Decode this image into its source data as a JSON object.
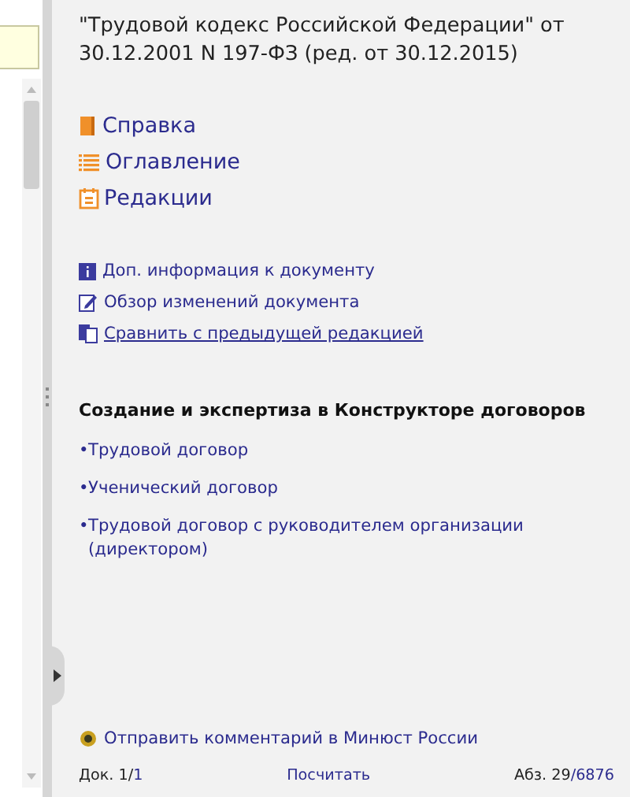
{
  "document": {
    "title": "\"Трудовой кодекс Российской Федерации\" от 30.12.2001 N 197-ФЗ (ред. от 30.12.2015)"
  },
  "main_links": [
    {
      "kind": "book",
      "label": "Справка"
    },
    {
      "kind": "list",
      "label": "Оглавление"
    },
    {
      "kind": "calendar",
      "label": "Редакции"
    }
  ],
  "doc_links": [
    {
      "kind": "info",
      "label": "Доп. информация к документу",
      "underlined": false
    },
    {
      "kind": "edit",
      "label": "Обзор изменений документа",
      "underlined": false
    },
    {
      "kind": "compare",
      "label": "Сравнить с предыдущей редакцией",
      "underlined": true
    }
  ],
  "constructor": {
    "heading": "Создание и экспертиза в Конструкторе договоров",
    "items": [
      {
        "bullet": "•",
        "label": "Трудовой договор"
      },
      {
        "bullet": "•",
        "label": "Ученический договор"
      },
      {
        "bullet": "•",
        "label": "Трудовой договор с руководителем организации (директором)"
      }
    ]
  },
  "feedback_link": "Отправить комментарий в Минюст России",
  "status_bar": {
    "doc_label": "Док. 1/",
    "doc_value": "1",
    "count_link": "Посчитать",
    "para_label": "Абз. 29",
    "para_value": "/6876"
  }
}
